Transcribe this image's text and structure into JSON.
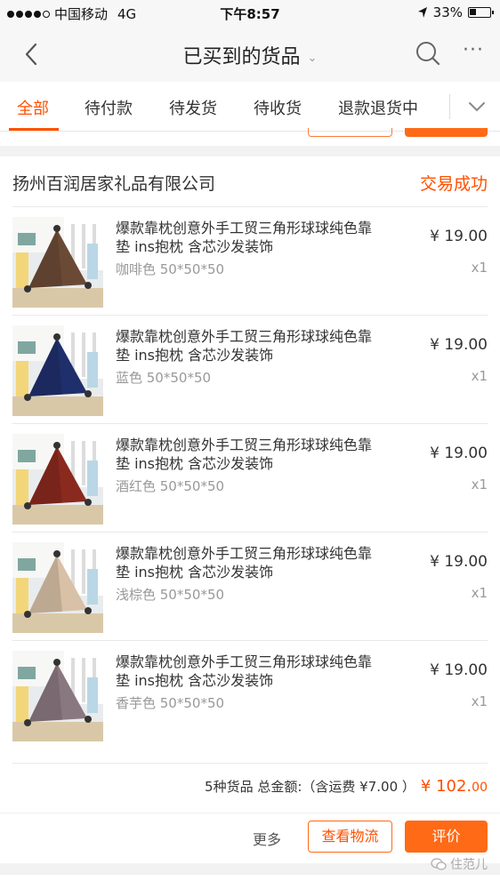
{
  "status_bar": {
    "carrier": "中国移动",
    "network": "4G",
    "time": "下午8:57",
    "battery": "33%",
    "battery_level": 0.33,
    "signal_bars": 4
  },
  "nav": {
    "title": "已买到的货品",
    "title_chevron": "⌄",
    "more": "···"
  },
  "tabs": [
    {
      "label": "全部",
      "active": true
    },
    {
      "label": "待付款",
      "active": false
    },
    {
      "label": "待发货",
      "active": false
    },
    {
      "label": "待收货",
      "active": false
    },
    {
      "label": "退款退货中",
      "active": false
    }
  ],
  "order": {
    "shop": "扬州百润居家礼品有限公司",
    "status": "交易成功",
    "items": [
      {
        "name": "爆款靠枕创意外手工贸三角形球球纯色靠垫 ins抱枕 含芯沙发装饰",
        "sku": "咖啡色 50*50*50",
        "price": "¥ 19.00",
        "qty": "x1",
        "color": "#6b4a35"
      },
      {
        "name": "爆款靠枕创意外手工贸三角形球球纯色靠垫 ins抱枕 含芯沙发装饰",
        "sku": "蓝色 50*50*50",
        "price": "¥ 19.00",
        "qty": "x1",
        "color": "#1f2f6b"
      },
      {
        "name": "爆款靠枕创意外手工贸三角形球球纯色靠垫 ins抱枕 含芯沙发装饰",
        "sku": "酒红色 50*50*50",
        "price": "¥ 19.00",
        "qty": "x1",
        "color": "#8a2a1e"
      },
      {
        "name": "爆款靠枕创意外手工贸三角形球球纯色靠垫 ins抱枕 含芯沙发装饰",
        "sku": "浅棕色 50*50*50",
        "price": "¥ 19.00",
        "qty": "x1",
        "color": "#d8c1a6"
      },
      {
        "name": "爆款靠枕创意外手工贸三角形球球纯色靠垫 ins抱枕 含芯沙发装饰",
        "sku": "香芋色 50*50*50",
        "price": "¥ 19.00",
        "qty": "x1",
        "color": "#8a7880"
      }
    ],
    "summary_text": "5种货品 总金额:（含运费 ¥7.00 ）",
    "total_main": "¥ 102.",
    "total_cents": "00",
    "more_label": "更多",
    "logistics_label": "查看物流",
    "review_label": "评价"
  },
  "watermark": "住范儿",
  "colors": {
    "accent": "#ff5000",
    "button_fill": "#ff6a16"
  }
}
